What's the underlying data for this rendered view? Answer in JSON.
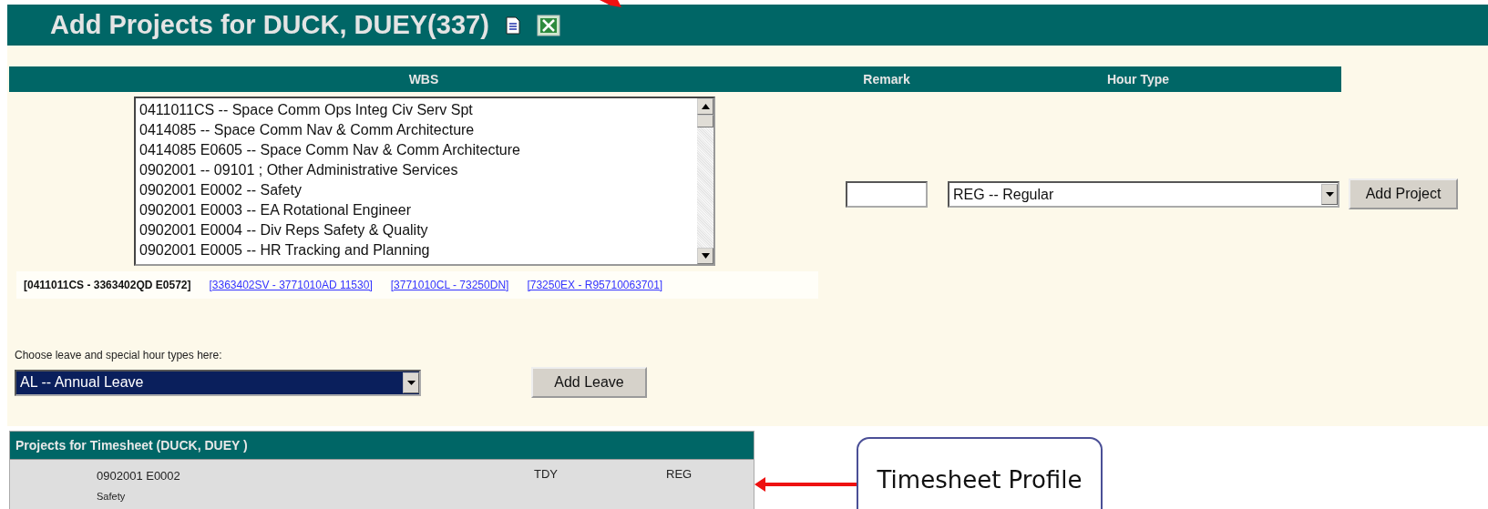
{
  "header": {
    "title": "Add Projects for DUCK, DUEY(337)"
  },
  "columns": [
    "WBS",
    "Remark",
    "Hour Type"
  ],
  "wbs_list": {
    "items": [
      {
        "label": "0411011CS -- Space Comm Ops Integ Civ Serv Spt"
      },
      {
        "label": "0414085 -- Space Comm Nav & Comm Architecture"
      },
      {
        "label": "0414085 E0605 -- Space Comm Nav & Comm Architecture"
      },
      {
        "label": "0902001 -- 09101 ; Other Administrative Services"
      },
      {
        "label": "0902001 E0002 -- Safety"
      },
      {
        "label": "0902001 E0003 -- EA Rotational Engineer"
      },
      {
        "label": "0902001 E0004 -- Div Reps Safety & Quality"
      },
      {
        "label": "0902001 E0005 -- HR Tracking and Planning"
      }
    ]
  },
  "ranges": [
    {
      "label": "[0411011CS - 3363402QD E0572]",
      "kind": "current"
    },
    {
      "label": "[3363402SV - 3771010AD 11530]",
      "kind": "link"
    },
    {
      "label": "[3771010CL - 73250DN]",
      "kind": "link"
    },
    {
      "label": "[73250EX - R95710063701]",
      "kind": "link"
    }
  ],
  "hour_type": {
    "value": "REG -- Regular"
  },
  "add_project_button": "Add Project",
  "leave": {
    "label": "Choose leave and special hour types here:",
    "value": "AL -- Annual Leave",
    "highlighted": true
  },
  "add_leave_button": "Add Leave",
  "timesheet": {
    "title": "Projects for Timesheet (DUCK, DUEY )",
    "rows": [
      {
        "code": "0902001 E0002",
        "name": "Safety",
        "location": "TDY",
        "hour_type": "REG"
      }
    ]
  },
  "callout": {
    "text": "Timesheet Profile"
  }
}
